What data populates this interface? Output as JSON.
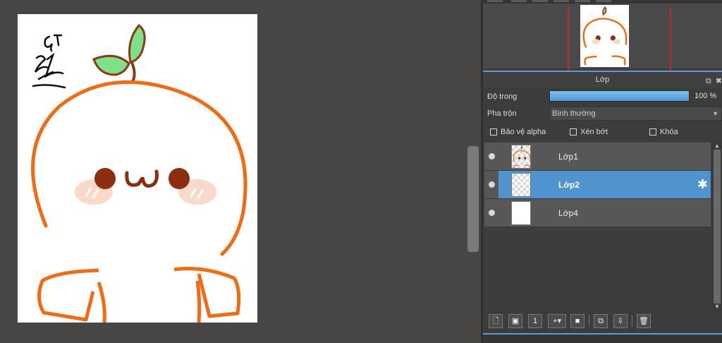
{
  "layer_panel": {
    "title": "Lớp",
    "opacity_label": "Độ trong",
    "opacity_value": "100 %",
    "opacity_fraction": 1.0,
    "blend_label": "Pha trộn",
    "blend_mode": "Bình thường",
    "checkboxes": [
      {
        "label": "Bảo vệ alpha",
        "checked": false
      },
      {
        "label": "Xén bớt",
        "checked": false
      },
      {
        "label": "Khóa",
        "checked": false
      }
    ],
    "layers": [
      {
        "name": "Lớp1",
        "selected": false,
        "visible": true
      },
      {
        "name": "Lớp2",
        "selected": true,
        "visible": true
      },
      {
        "name": "Lớp4",
        "selected": false,
        "visible": true
      }
    ]
  },
  "colors": {
    "accent": "#4f93cf",
    "navigator_frame": "#c0292b",
    "stroke_orange": "#f26b12",
    "leaf_green": "#7fe08a"
  },
  "icons": {
    "layer_toolbar": [
      "new-layer-icon",
      "new-vector-layer-icon",
      "new-1bit-layer-icon",
      "new-layer-dropdown-icon",
      "folder-icon",
      "duplicate-icon",
      "merge-icon",
      "delete-icon"
    ],
    "header": [
      "undock-icon",
      "close-icon"
    ],
    "selected_layer": "gear-icon"
  }
}
